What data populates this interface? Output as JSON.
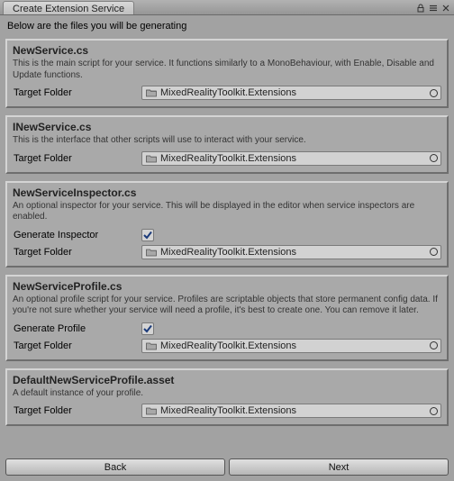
{
  "window": {
    "title": "Create Extension Service"
  },
  "intro": "Below are the files you will be generating",
  "labels": {
    "target_folder": "Target Folder",
    "generate_inspector": "Generate Inspector",
    "generate_profile": "Generate Profile"
  },
  "folder_value": "MixedRealityToolkit.Extensions",
  "panels": {
    "new_service": {
      "title": "NewService.cs",
      "desc": "This is the main script for your service. It functions similarly to a MonoBehaviour, with Enable, Disable and Update functions."
    },
    "inew_service": {
      "title": "INewService.cs",
      "desc": "This is the interface that other scripts will use to interact with your service."
    },
    "inspector": {
      "title": "NewServiceInspector.cs",
      "desc": "An optional inspector for your service. This will be displayed in the editor when service inspectors are enabled.",
      "checked": true
    },
    "profile": {
      "title": "NewServiceProfile.cs",
      "desc": "An optional profile script for your service. Profiles are scriptable objects that store permanent config data. If you're not sure whether your service will need a profile, it's best to create one. You can remove it later.",
      "checked": true
    },
    "default_asset": {
      "title": "DefaultNewServiceProfile.asset",
      "desc": "A default instance of your profile."
    }
  },
  "buttons": {
    "back": "Back",
    "next": "Next"
  }
}
